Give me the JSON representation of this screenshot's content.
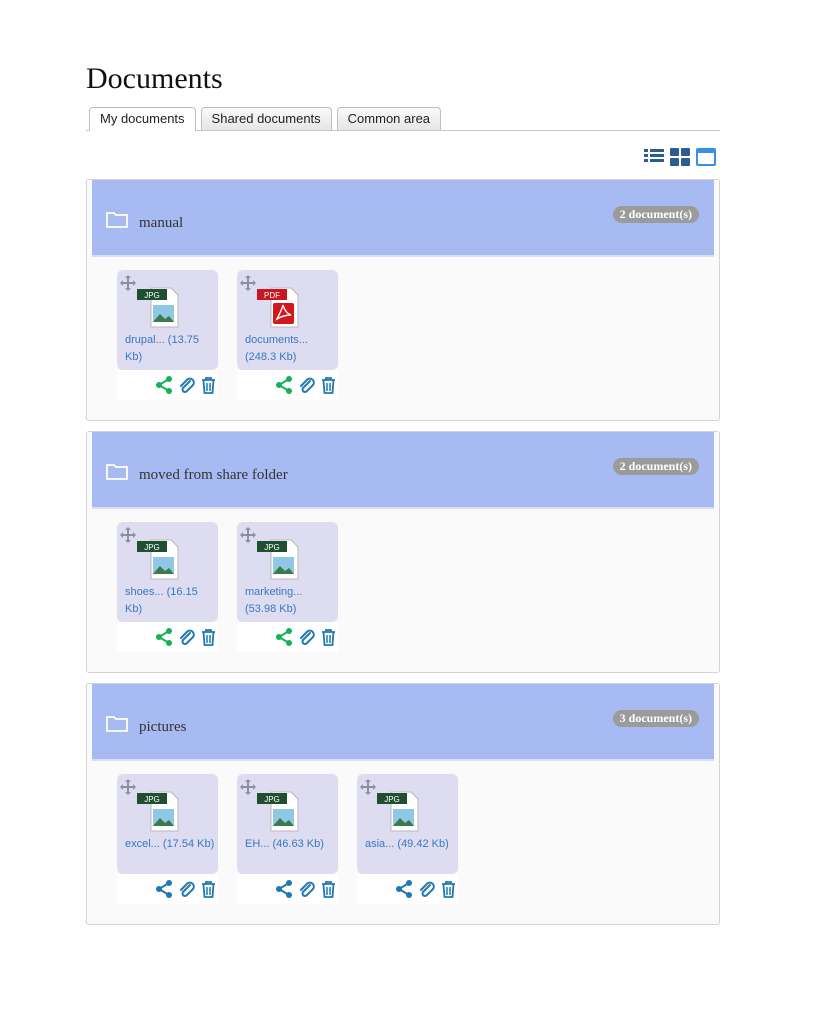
{
  "page": {
    "title": "Documents"
  },
  "tabs": [
    {
      "label": "My documents",
      "active": true
    },
    {
      "label": "Shared documents",
      "active": false
    },
    {
      "label": "Common area",
      "active": false
    }
  ],
  "view_switch": [
    "list-view-icon",
    "grid-view-icon",
    "window-view-icon"
  ],
  "colors": {
    "folder_header": "#a8baf2",
    "card": "#dedcf0",
    "link": "#3778c4",
    "share_green": "#19b05a",
    "action_blue": "#1f78b4"
  },
  "folders": [
    {
      "name": "manual",
      "count": "2 document(s)",
      "files": [
        {
          "type": "JPG",
          "name": "drupal... (13.75 Kb)",
          "share_color": "green"
        },
        {
          "type": "PDF",
          "name": "documents... (248.3 Kb)",
          "share_color": "green"
        }
      ]
    },
    {
      "name": "moved from share folder",
      "count": "2 document(s)",
      "files": [
        {
          "type": "JPG",
          "name": "shoes... (16.15 Kb)",
          "share_color": "green"
        },
        {
          "type": "JPG",
          "name": "marketing... (53.98 Kb)",
          "share_color": "green"
        }
      ]
    },
    {
      "name": "pictures",
      "count": "3 document(s)",
      "files": [
        {
          "type": "JPG",
          "name": "excel... (17.54 Kb)",
          "share_color": "blue"
        },
        {
          "type": "JPG",
          "name": "EH... (46.63 Kb)",
          "share_color": "blue"
        },
        {
          "type": "JPG",
          "name": "asia... (49.42 Kb)",
          "share_color": "blue"
        }
      ]
    }
  ]
}
